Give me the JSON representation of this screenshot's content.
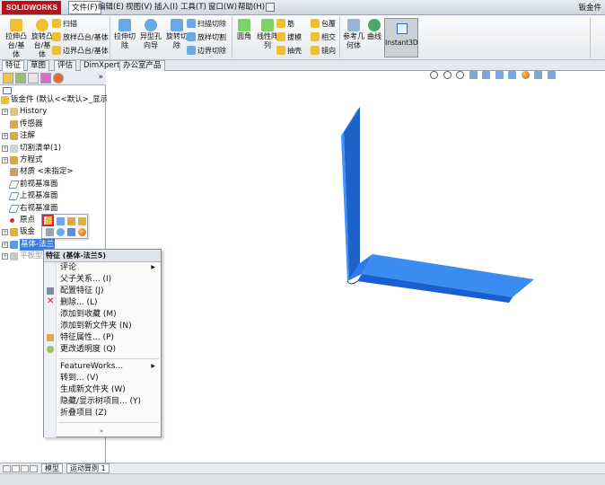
{
  "app": {
    "logo_text": "SOLIDWORKS",
    "doc_title": "钣金件"
  },
  "menus": [
    "文件(F)",
    "编辑(E)",
    "视图(V)",
    "插入(I)",
    "工具(T)",
    "窗口(W)",
    "帮助(H)"
  ],
  "toolbar": {
    "big_buttons": [
      {
        "label1": "拉伸凸",
        "label2": "台/基",
        "label3": "体"
      },
      {
        "label1": "旋转凸",
        "label2": "台/基",
        "label3": "体"
      },
      {
        "label1": "拉伸切",
        "label2": "除",
        "label3": ""
      },
      {
        "label1": "异型孔",
        "label2": "向导",
        "label3": ""
      },
      {
        "label1": "旋转切",
        "label2": "除",
        "label3": ""
      },
      {
        "label1": "圆角",
        "label2": "",
        "label3": ""
      },
      {
        "label1": "线性阵",
        "label2": "列",
        "label3": ""
      },
      {
        "label1": "参考几",
        "label2": "何体",
        "label3": ""
      },
      {
        "label1": "曲线",
        "label2": "",
        "label3": ""
      }
    ],
    "small_col1": [
      "扫描",
      "放样凸台/基体",
      "边界凸台/基体"
    ],
    "small_col2": [
      "扫描切除",
      "放样切割",
      "边界切除"
    ],
    "small_col3": [
      "筋",
      "拔模",
      "抽壳"
    ],
    "small_col4": [
      "包覆",
      "相交",
      "镜向"
    ],
    "instant3d": "Instant3D"
  },
  "command_tabs": [
    "特征",
    "草图",
    "评估",
    "DimXpert",
    "办公室产品"
  ],
  "tree": {
    "root": "钣金件 (默认<<默认>_显示状",
    "items": [
      "History",
      "传感器",
      "注解",
      "切割清单(1)",
      "方程式",
      "材质 <未指定>",
      "前视基准面",
      "上视基准面",
      "右视基准面",
      "原点",
      "钣金",
      "基体-法兰",
      "平板型式"
    ]
  },
  "context_menu": {
    "header": "特征 (基体-法兰5)",
    "group1": [
      "评论",
      "父子关系... (I)",
      "配置特征 (J)",
      "删除... (L)",
      "添加到收藏 (M)",
      "添加到新文件夹 (N)",
      "特征属性... (P)",
      "更改透明度 (Q)"
    ],
    "group2": [
      "FeatureWorks...",
      "转到... (V)",
      "生成新文件夹 (W)",
      "隐藏/显示树项目... (Y)",
      "折叠项目 (Z)"
    ],
    "more": "»"
  },
  "bottom_tabs": [
    "模型",
    "运动算例 1"
  ],
  "colors": {
    "part_blue": "#1e6fe0",
    "part_edge": "#2f86ff",
    "selection": "#3a7de0",
    "highlight": "#e0202a"
  }
}
